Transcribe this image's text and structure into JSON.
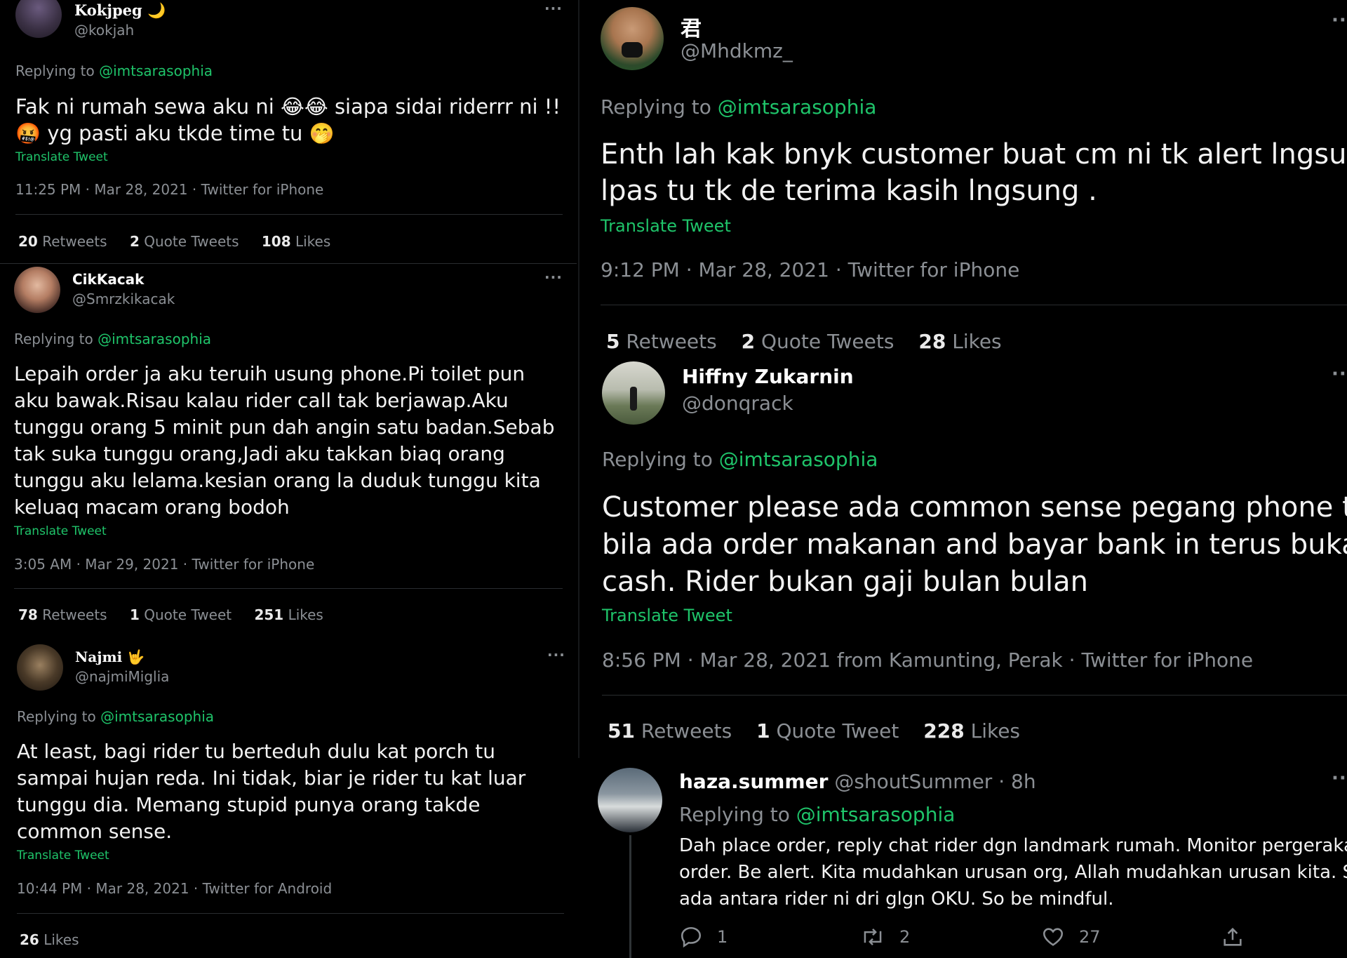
{
  "left": {
    "tweets": [
      {
        "name": "Kokjpeg 🌙",
        "handle": "@kokjah",
        "replying_prefix": "Replying to ",
        "replying_to": "@imtsarasophia",
        "lines": [
          "Fak ni rumah sewa aku ni 😂😂 siapa sidai riderrr ni !!",
          "🤬 yg pasti aku tkde time tu 🤭"
        ],
        "translate": "Translate Tweet",
        "meta": "11:25 PM · Mar 28, 2021 · Twitter for iPhone",
        "stats": [
          {
            "count": "20",
            "label": "Retweets"
          },
          {
            "count": "2",
            "label": "Quote Tweets"
          },
          {
            "count": "108",
            "label": "Likes"
          }
        ]
      },
      {
        "name": "CikKacak",
        "handle": "@Smrzkikacak",
        "replying_prefix": "Replying to ",
        "replying_to": "@imtsarasophia",
        "lines": [
          "Lepaih order ja aku teruih usung phone.Pi toilet pun",
          "aku bawak.Risau kalau rider call tak berjawap.Aku",
          "tunggu orang 5 minit pun dah angin satu badan.Sebab",
          "tak suka tunggu orang,Jadi aku takkan biaq orang",
          "tunggu aku lelama.kesian orang la duduk tunggu kita",
          "keluaq macam orang bodoh"
        ],
        "translate": "Translate Tweet",
        "meta": "3:05 AM · Mar 29, 2021 · Twitter for iPhone",
        "stats": [
          {
            "count": "78",
            "label": "Retweets"
          },
          {
            "count": "1",
            "label": "Quote Tweet"
          },
          {
            "count": "251",
            "label": "Likes"
          }
        ]
      },
      {
        "name": "Najmi 🤟",
        "handle": "@najmiMiglia",
        "replying_prefix": "Replying to ",
        "replying_to": "@imtsarasophia",
        "lines": [
          "At least, bagi rider tu berteduh dulu kat porch tu",
          "sampai hujan reda. Ini tidak, biar je rider tu kat luar",
          "tunggu dia. Memang stupid punya orang takde",
          "common sense."
        ],
        "translate": "Translate Tweet",
        "meta": "10:44 PM · Mar 28, 2021 · Twitter for Android",
        "stats": [
          {
            "count": "26",
            "label": "Likes"
          }
        ]
      }
    ]
  },
  "right": {
    "tweets": [
      {
        "name": "君",
        "handle": "@Mhdkmz_",
        "replying_prefix": "Replying to ",
        "replying_to": "@imtsarasophia",
        "lines": [
          "Enth lah kak bnyk customer buat cm ni tk alert lngsung",
          "lpas tu tk de terima kasih lngsung ."
        ],
        "translate": "Translate Tweet",
        "meta": "9:12 PM · Mar 28, 2021 · Twitter for iPhone",
        "stats": [
          {
            "count": "5",
            "label": "Retweets"
          },
          {
            "count": "2",
            "label": "Quote Tweets"
          },
          {
            "count": "28",
            "label": "Likes"
          }
        ]
      },
      {
        "name": "Hiffny Zukarnin",
        "handle": "@donqrack",
        "replying_prefix": "Replying to ",
        "replying_to": "@imtsarasophia",
        "lines": [
          "Customer please ada common sense pegang phone tu",
          "bila ada order makanan and bayar bank in terus bukan",
          "cash. Rider bukan gaji bulan bulan"
        ],
        "translate": "Translate Tweet",
        "meta": "8:56 PM · Mar 28, 2021 from Kamunting, Perak · Twitter for iPhone",
        "stats": [
          {
            "count": "51",
            "label": "Retweets"
          },
          {
            "count": "1",
            "label": "Quote Tweet"
          },
          {
            "count": "228",
            "label": "Likes"
          }
        ]
      },
      {
        "name": "haza.summer",
        "handle": "@shoutSummer · 8h",
        "replying_prefix": "Replying to ",
        "replying_to": "@imtsarasophia",
        "lines": [
          "Dah place order, reply chat rider dgn landmark rumah. Monitor pergerakan",
          "order. Be alert. Kita mudahkan urusan org, Allah mudahkan urusan kita. Sbb",
          "ada antara rider ni dri glgn OKU. So be mindful."
        ],
        "actions": {
          "replies": "1",
          "retweets": "2",
          "likes": "27"
        }
      }
    ]
  },
  "more_label": "···",
  "colors": {
    "background": "#000000",
    "accent": "#1fc46a",
    "muted": "#8b8f94",
    "text": "#f2f2f2",
    "divider": "#2a2d30"
  }
}
